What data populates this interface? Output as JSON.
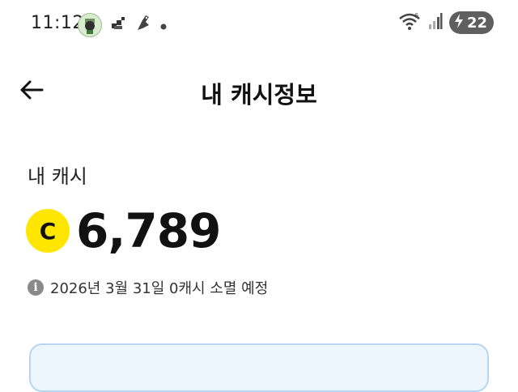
{
  "status_bar": {
    "time": "11:12",
    "battery": "22",
    "icons": [
      "app-avatar-icon",
      "photo-icon",
      "bird-icon",
      "dot-icon",
      "wifi-icon",
      "signal-icon",
      "battery-charging-icon"
    ]
  },
  "header": {
    "title": "내 캐시정보"
  },
  "cash": {
    "label": "내 캐시",
    "coin_symbol": "C",
    "amount": "6,789",
    "expiry_notice": "2026년 3월 31일 0캐시 소멸 예정",
    "info_symbol": "i"
  },
  "colors": {
    "coin": "#ffe600",
    "card_border": "#b8d6f0",
    "card_bg": "#eef6fd"
  }
}
